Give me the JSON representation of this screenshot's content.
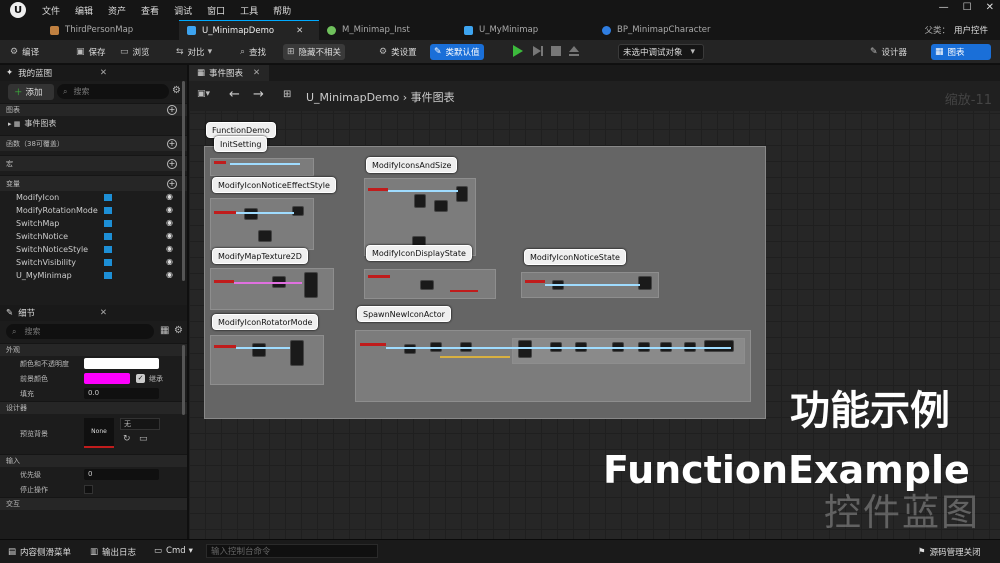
{
  "menu": {
    "items": [
      "文件",
      "编辑",
      "资产",
      "查看",
      "调试",
      "窗口",
      "工具",
      "帮助"
    ]
  },
  "tabs": [
    {
      "label": "ThirdPersonMap",
      "color": "#c08040"
    },
    {
      "label": "U_MinimapDemo",
      "color": "#3da4f0"
    },
    {
      "label": "M_Minimap_Inst",
      "color": "#6fc05c"
    },
    {
      "label": "U_MyMinimap",
      "color": "#3da4f0"
    },
    {
      "label": "BP_MinimapCharacter",
      "color": "#2f7de0"
    }
  ],
  "parent": {
    "label": "父类：",
    "value": "用户控件"
  },
  "toolbar": {
    "compile": "编译",
    "save": "保存",
    "browse": "浏览",
    "diff": "对比",
    "find": "查找",
    "hide_unrelated": "隐藏不相关",
    "class_settings": "类设置",
    "class_defaults": "类默认值",
    "debug_object": "未选中调试对象",
    "designer": "设计器",
    "graph": "图表"
  },
  "my_blueprint": {
    "title": "我的蓝图",
    "add": "添加",
    "search_placeholder": "搜索",
    "sections": {
      "graphs": "图表",
      "event_graph": "事件图表",
      "functions": "函数（38可覆盖）",
      "macros": "宏",
      "variables": "变量"
    },
    "variables": [
      "ModifyIcon",
      "ModifyRotationMode",
      "SwitchMap",
      "SwitchNotice",
      "SwitchNoticeStyle",
      "SwitchVisibility",
      "U_MyMinimap"
    ]
  },
  "details": {
    "title": "细节",
    "search_placeholder": "搜索",
    "sec_appearance": "外观",
    "color_opacity": "颜色和不透明度",
    "fg_color": "前景颜色",
    "inherit": "继承",
    "padding": "填充",
    "padding_value": "0.0",
    "sec_designer": "设计器",
    "preview_bg": "预览背景",
    "none": "None",
    "none_option": "无",
    "sec_input": "输入",
    "priority": "优先级",
    "priority_value": "0",
    "stop_action": "停止操作",
    "sec_interaction": "交互"
  },
  "graph": {
    "tab": "事件图表",
    "breadcrumb_root": "U_MinimapDemo",
    "breadcrumb_leaf": "事件图表",
    "zoom": "缩放-11",
    "comments": [
      "FunctionDemo",
      "InitSetting",
      "ModifyIconNoticeEffectStyle",
      "ModifyMapTexture2D",
      "ModifyIconRotatorMode",
      "ModifyIconsAndSize",
      "ModifyIconDisplayState",
      "SpawnNewIconActor",
      "ModifyIconNoticeState"
    ]
  },
  "overlay": {
    "cn_title": "功能示例",
    "en_title": "FunctionExample",
    "watermark": "控件蓝图"
  },
  "statusbar": {
    "content_drawer": "内容侧滑菜单",
    "output_log": "输出日志",
    "cmd": "Cmd",
    "console_placeholder": "输入控制台命令",
    "source_control": "源码管理关闭"
  },
  "colors": {
    "accent": "#1a6fd8",
    "fg_swatch": "#ff00ff",
    "variable_icon": "#1d8fd6"
  }
}
